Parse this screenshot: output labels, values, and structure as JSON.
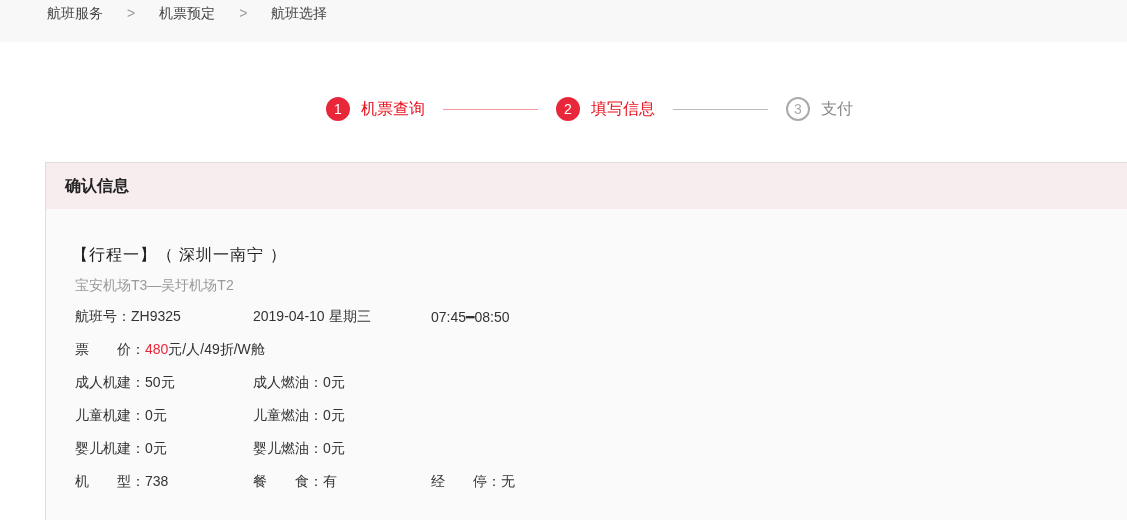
{
  "breadcrumb": {
    "items": [
      "航班服务",
      "机票预定",
      "航班选择"
    ],
    "separator": ">"
  },
  "steps": [
    {
      "number": "1",
      "label": "机票查询",
      "done": true
    },
    {
      "number": "2",
      "label": "填写信息",
      "done": true
    },
    {
      "number": "3",
      "label": "支付",
      "done": false
    }
  ],
  "card": {
    "title": "确认信息",
    "trip_title": "【行程一】（ 深圳一南宁 ）",
    "airports": "宝安机场T3—吴圩机场T2",
    "flight_row": [
      {
        "label": "航班号：",
        "value": "ZH9325"
      },
      {
        "value": "2019-04-10 星期三"
      },
      {
        "value": "07:45━08:50"
      }
    ],
    "price": {
      "label": "票　　价：",
      "amount": "480",
      "rest": "元/人/49折/W舱"
    },
    "rows": [
      [
        {
          "label": "成人机建：",
          "value": "50元"
        },
        {
          "label": "成人燃油：",
          "value": "0元"
        }
      ],
      [
        {
          "label": "儿童机建：",
          "value": "0元"
        },
        {
          "label": "儿童燃油：",
          "value": "0元"
        }
      ],
      [
        {
          "label": "婴儿机建：",
          "value": "0元"
        },
        {
          "label": "婴儿燃油：",
          "value": "0元"
        }
      ],
      [
        {
          "label": "机　　型：",
          "value": "738"
        },
        {
          "label": "餐　　食：",
          "value": "有"
        },
        {
          "label": "经　　停：",
          "value": "无"
        }
      ]
    ]
  }
}
